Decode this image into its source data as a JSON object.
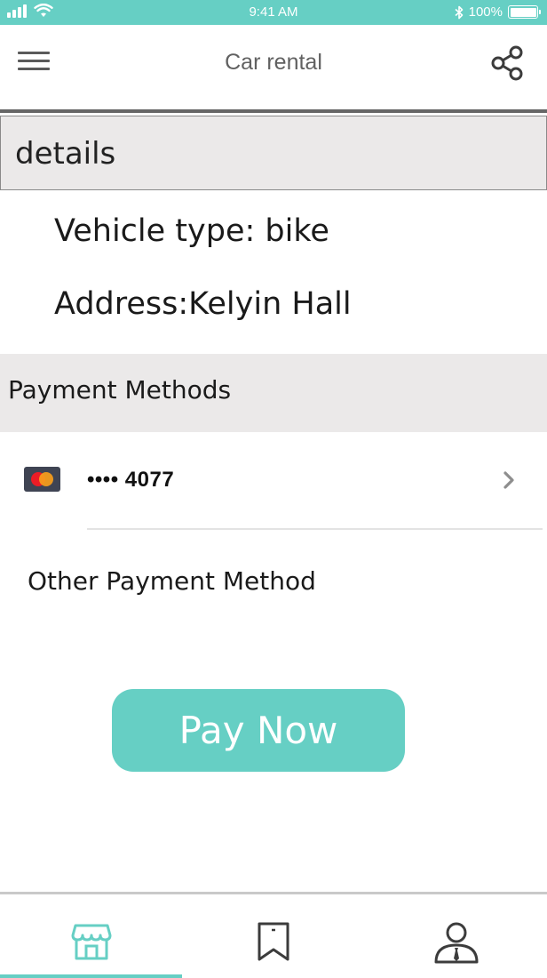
{
  "status_bar": {
    "time": "9:41 AM",
    "bluetooth_icon": "bluetooth-icon",
    "battery_label": "100%",
    "battery_level": 1.0
  },
  "header": {
    "title": "Car rental",
    "menu_icon": "menu-icon",
    "share_icon": "share-icon"
  },
  "details": {
    "section_title": "details",
    "vehicle": "Vehicle type: bike",
    "address": "Address:Kelyin Hall"
  },
  "payment": {
    "section_title": "Payment Methods",
    "card_icon": "mastercard-icon",
    "card_number": "•••• 4077",
    "other_method": "Other Payment Method",
    "pay_label": "Pay Now"
  },
  "tabs": [
    {
      "icon": "store-icon",
      "active": true
    },
    {
      "icon": "bookmark-icon",
      "active": false
    },
    {
      "icon": "profile-icon",
      "active": false
    }
  ],
  "colors": {
    "accent": "#66cfc4",
    "section_bg": "#ebe9e9",
    "icon_dark": "#3c3c3c"
  }
}
